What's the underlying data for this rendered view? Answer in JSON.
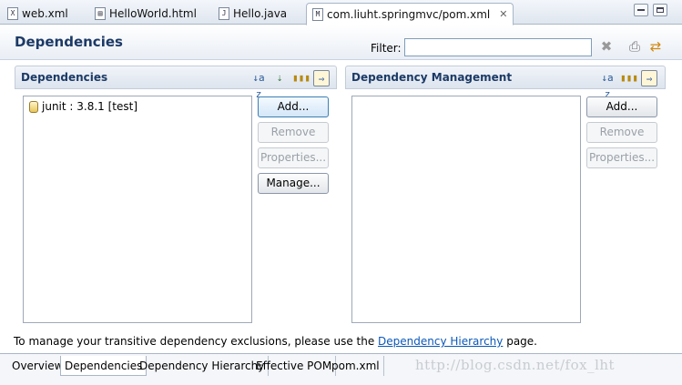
{
  "editor_tabs": [
    {
      "icon": "xml-file-icon",
      "glyph": "X",
      "label": "web.xml"
    },
    {
      "icon": "html-file-icon",
      "glyph": "▤",
      "label": "HelloWorld.html"
    },
    {
      "icon": "java-file-icon",
      "glyph": "J",
      "label": "Hello.java"
    },
    {
      "icon": "pom-file-icon",
      "glyph": "M",
      "label": "com.liuht.springmvc/pom.xml",
      "active": true,
      "close": "✕"
    }
  ],
  "header": {
    "title": "Dependencies",
    "filter_label": "Filter:",
    "filter_value": "",
    "clear_glyph": "✖",
    "icon_a": "⎙",
    "icon_b": "⇄"
  },
  "dependencies": {
    "title": "Dependencies",
    "toolbar": [
      "↓a z",
      "⇣",
      "▮▮▮",
      "⇒"
    ],
    "items": [
      {
        "label": "junit : 3.8.1 [test]"
      }
    ],
    "buttons": {
      "add": "Add...",
      "remove": "Remove",
      "properties": "Properties...",
      "manage": "Manage..."
    }
  },
  "dependency_management": {
    "title": "Dependency Management",
    "toolbar": [
      "↓a z",
      "▮▮▮",
      "⇒"
    ],
    "items": [],
    "buttons": {
      "add": "Add...",
      "remove": "Remove",
      "properties": "Properties..."
    }
  },
  "hint": {
    "before": "To manage your transitive dependency exclusions, please use the ",
    "link": "Dependency Hierarchy",
    "after": " page."
  },
  "page_tabs": [
    {
      "label": "Overview"
    },
    {
      "label": "Dependencies",
      "active": true
    },
    {
      "label": "Dependency Hierarchy"
    },
    {
      "label": "Effective POM"
    },
    {
      "label": "pom.xml"
    }
  ],
  "watermark": "http://blog.csdn.net/fox_lht",
  "colors": {
    "section_title": "#1c3a66",
    "link": "#0b58b8",
    "default_button_border": "#3c7fb1"
  }
}
